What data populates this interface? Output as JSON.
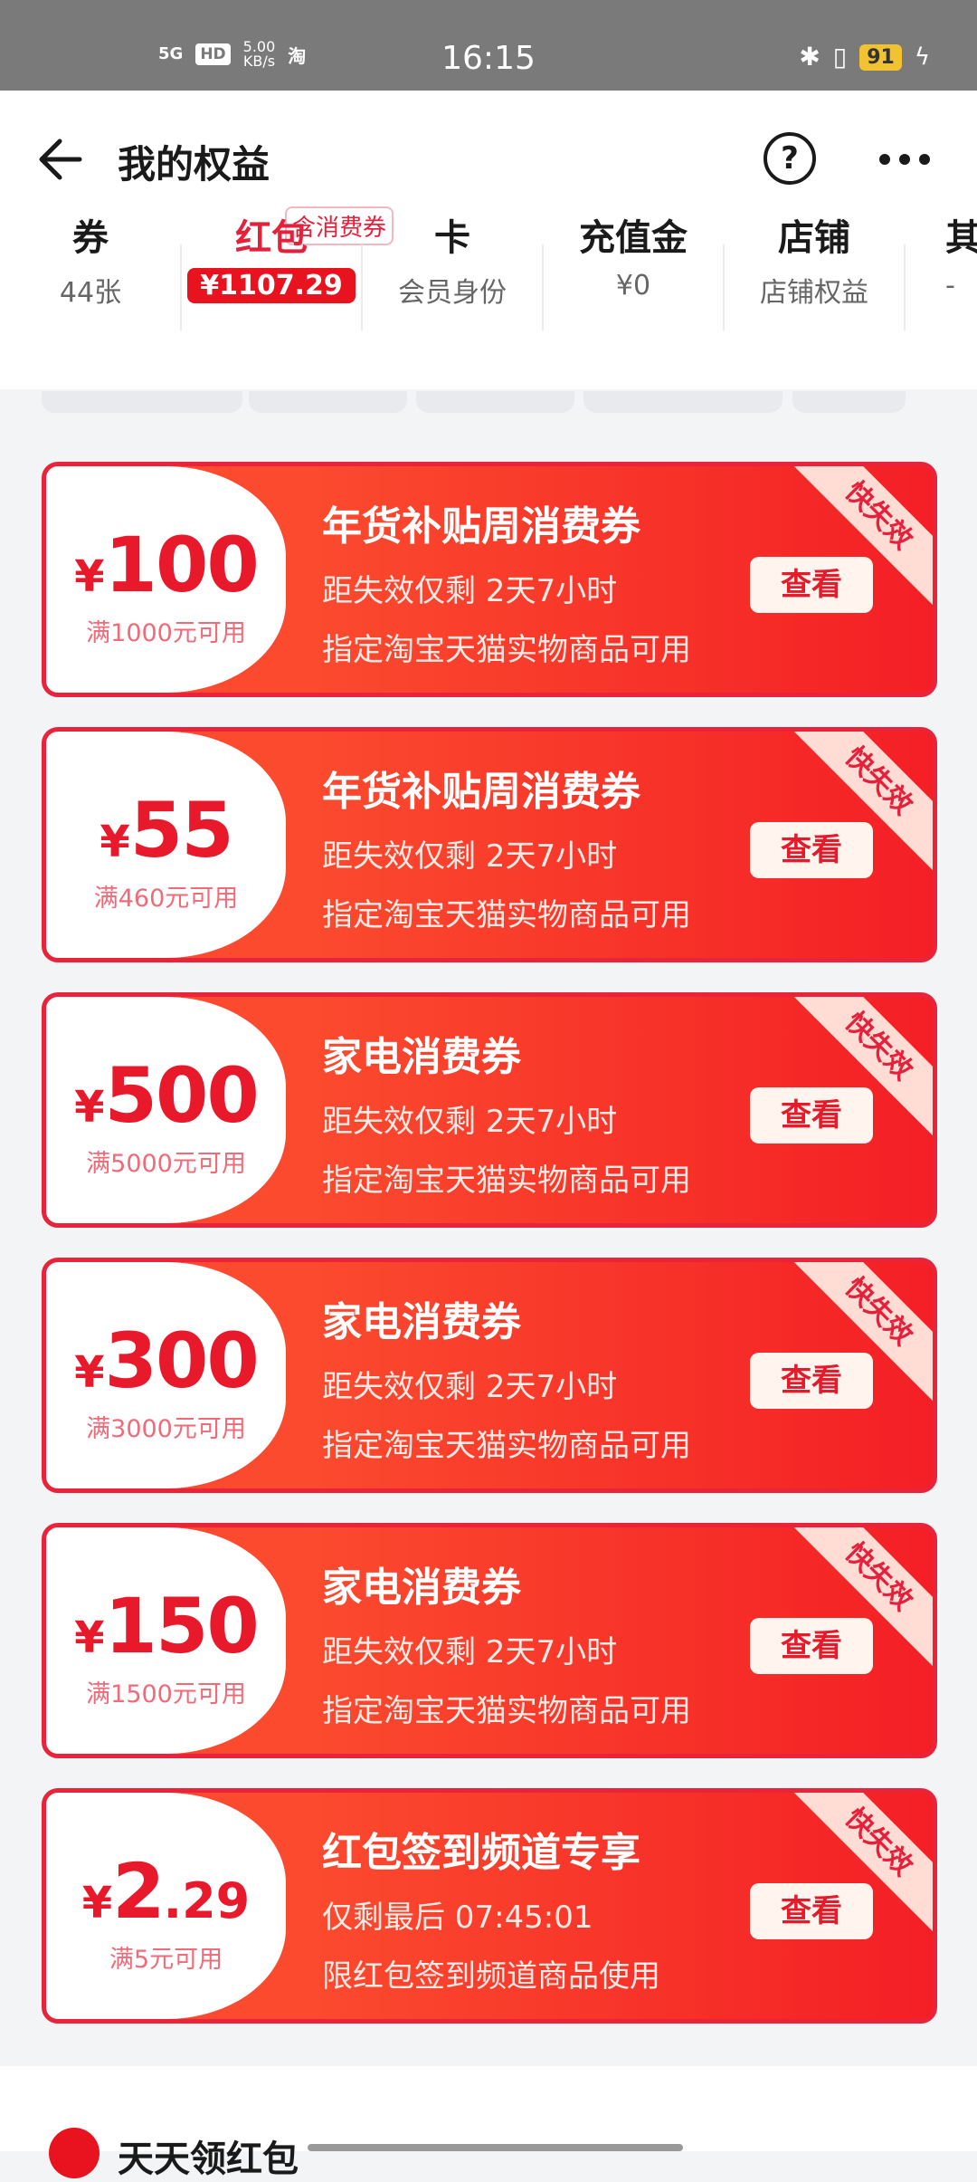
{
  "status_bar": {
    "network": "5G",
    "hd": "HD",
    "speed": "5.00\nKB/s",
    "app_icon": "淘",
    "time": "16:15",
    "battery": "91"
  },
  "header": {
    "title": "我的权益"
  },
  "tabs": [
    {
      "title": "券",
      "sub": "44张"
    },
    {
      "title": "红包",
      "badge": "含消费券",
      "money": "¥1107.29"
    },
    {
      "title": "卡",
      "sub": "会员身份"
    },
    {
      "title": "充值金",
      "sub": "¥0"
    },
    {
      "title": "店铺",
      "sub": "店铺权益"
    },
    {
      "title": "其",
      "sub": "-"
    }
  ],
  "coupons": [
    {
      "yen": "¥",
      "num": "100",
      "dec": "",
      "threshold": "满1000元可用",
      "title": "年货补贴周消费券",
      "line1": "距失效仅剩 2天7小时",
      "line2": "指定淘宝天猫实物商品可用",
      "button": "查看",
      "ribbon": "快失效"
    },
    {
      "yen": "¥",
      "num": "55",
      "dec": "",
      "threshold": "满460元可用",
      "title": "年货补贴周消费券",
      "line1": "距失效仅剩 2天7小时",
      "line2": "指定淘宝天猫实物商品可用",
      "button": "查看",
      "ribbon": "快失效"
    },
    {
      "yen": "¥",
      "num": "500",
      "dec": "",
      "threshold": "满5000元可用",
      "title": "家电消费券",
      "line1": "距失效仅剩 2天7小时",
      "line2": "指定淘宝天猫实物商品可用",
      "button": "查看",
      "ribbon": "快失效"
    },
    {
      "yen": "¥",
      "num": "300",
      "dec": "",
      "threshold": "满3000元可用",
      "title": "家电消费券",
      "line1": "距失效仅剩 2天7小时",
      "line2": "指定淘宝天猫实物商品可用",
      "button": "查看",
      "ribbon": "快失效"
    },
    {
      "yen": "¥",
      "num": "150",
      "dec": "",
      "threshold": "满1500元可用",
      "title": "家电消费券",
      "line1": "距失效仅剩 2天7小时",
      "line2": "指定淘宝天猫实物商品可用",
      "button": "查看",
      "ribbon": "快失效"
    },
    {
      "yen": "¥",
      "num": "2",
      "dec": ".29",
      "threshold": "满5元可用",
      "title": "红包签到频道专享",
      "line1": "仅剩最后 07:45:01",
      "line2": "限红包签到频道商品使用",
      "button": "查看",
      "ribbon": "快失效"
    }
  ],
  "bottom": {
    "title": "天天领红包"
  }
}
